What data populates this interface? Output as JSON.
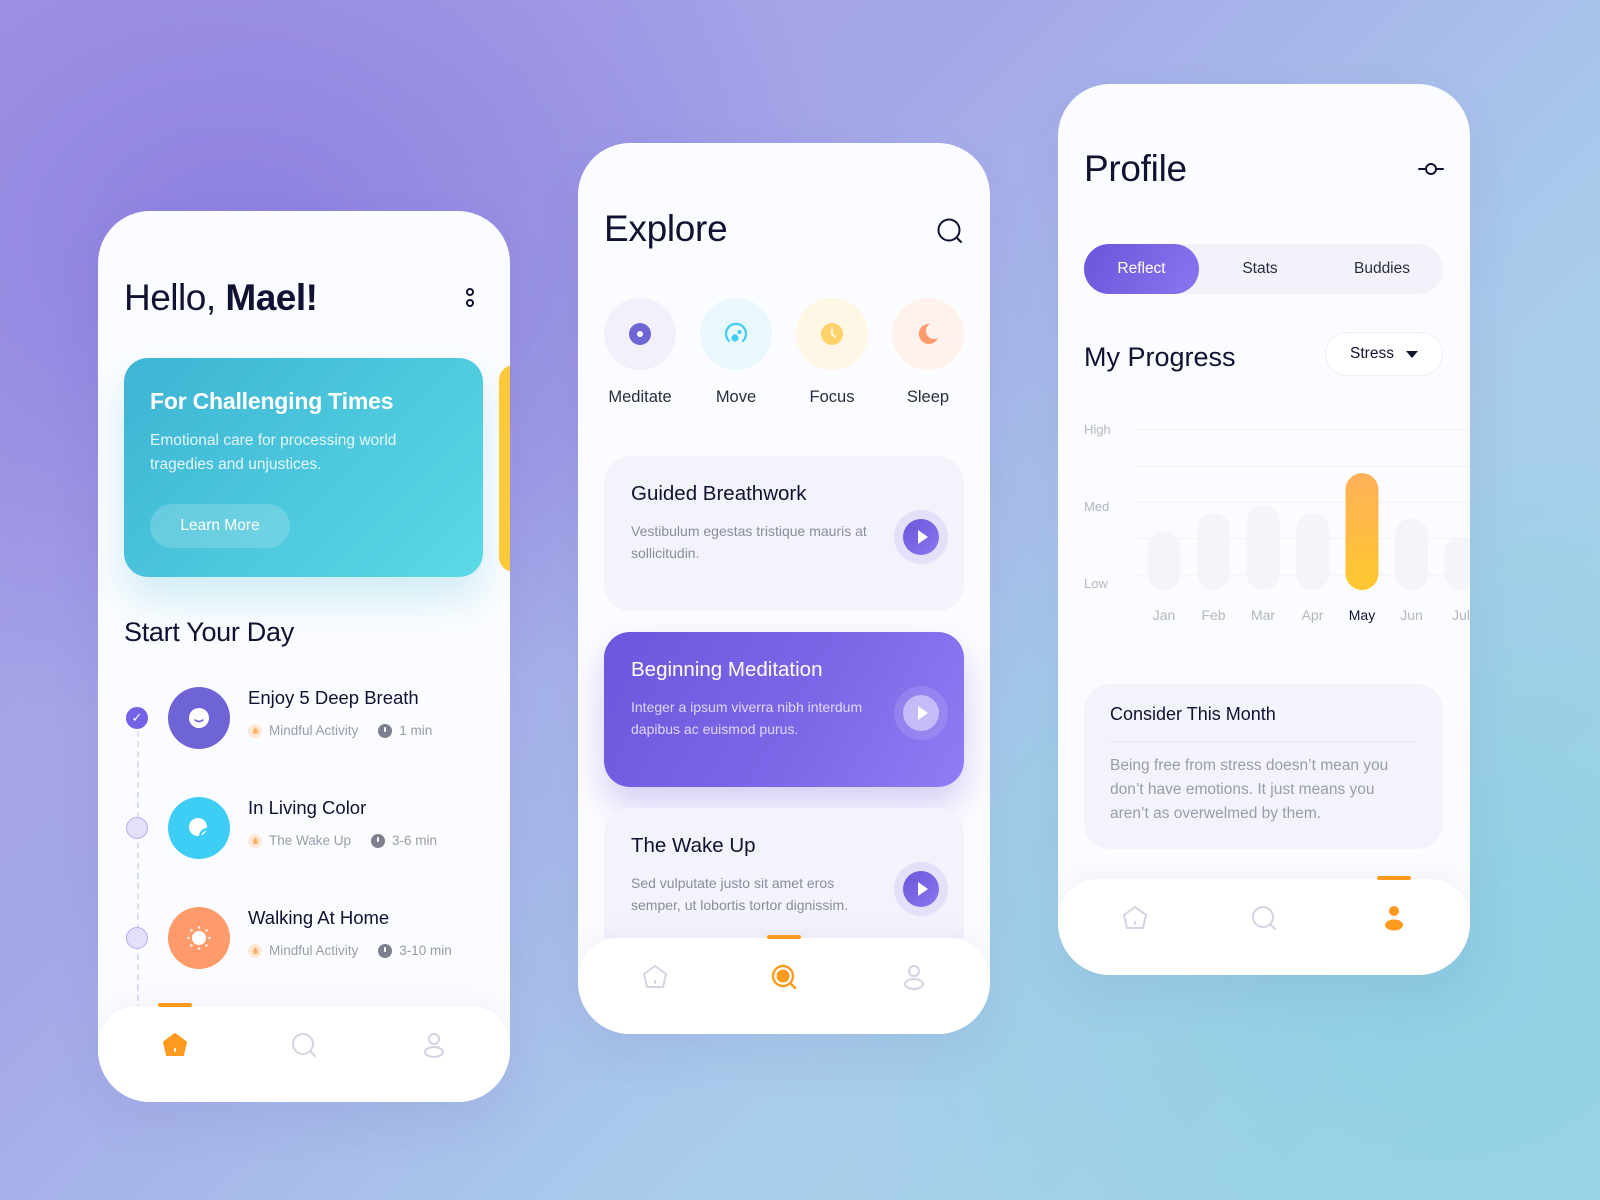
{
  "colors": {
    "accent_purple": "#6b57dc",
    "accent_orange": "#ff9a1f",
    "hero_teal": "#4fcade",
    "peek_yellow": "#ffc93c",
    "text_dark": "#0f1230",
    "text_muted": "#9a9cab"
  },
  "home": {
    "greeting_prefix": "Hello,",
    "greeting_name": "Mael!",
    "menu_icon": "more-vertical-icon",
    "hero": {
      "title": "For Challenging Times",
      "subtitle": "Emotional care for processing world tragedies and unjustices.",
      "button": "Learn More"
    },
    "section_title": "Start Your Day",
    "tasks": [
      {
        "title": "Enjoy 5 Deep Breath",
        "category": "Mindful Activity",
        "duration": "1 min",
        "done": true,
        "icon": "smile-icon",
        "color": "#6e64d6"
      },
      {
        "title": "In Living Color",
        "category": "The Wake Up",
        "duration": "3-6 min",
        "done": false,
        "icon": "color-icon",
        "color": "#3ecdf5"
      },
      {
        "title": "Walking At Home",
        "category": "Mindful Activity",
        "duration": "3-10 min",
        "done": false,
        "icon": "sun-icon",
        "color": "#ff9a6a"
      }
    ],
    "tabbar": {
      "active": "home",
      "tabs": [
        "home",
        "search",
        "profile"
      ]
    }
  },
  "explore": {
    "title": "Explore",
    "categories": [
      {
        "label": "Meditate",
        "icon": "meditate-icon",
        "bg": "#f1f0fb",
        "fg": "#6e64d6"
      },
      {
        "label": "Move",
        "icon": "move-icon",
        "bg": "#eaf8fd",
        "fg": "#3ecdf5"
      },
      {
        "label": "Focus",
        "icon": "focus-icon",
        "bg": "#fff7e6",
        "fg": "#ffd36a"
      },
      {
        "label": "Sleep",
        "icon": "sleep-icon",
        "bg": "#fff1ec",
        "fg": "#ff9a6a"
      }
    ],
    "cards": [
      {
        "title": "Guided Breathwork",
        "desc": "Vestibulum egestas tristique mauris at sollicitudin.",
        "active": false
      },
      {
        "title": "Beginning Meditation",
        "desc": "Integer a ipsum viverra nibh interdum dapibus ac euismod purus.",
        "active": true
      },
      {
        "title": "The Wake Up",
        "desc": "Sed vulputate justo sit amet eros semper, ut lobortis tortor dignissim.",
        "active": false
      }
    ],
    "tabbar": {
      "active": "search",
      "tabs": [
        "home",
        "search",
        "profile"
      ]
    }
  },
  "profile": {
    "title": "Profile",
    "segments": [
      {
        "label": "Reflect",
        "active": true
      },
      {
        "label": "Stats",
        "active": false
      },
      {
        "label": "Buddies",
        "active": false
      }
    ],
    "progress_title": "My Progress",
    "filter_selected": "Stress",
    "consider": {
      "title": "Consider This Month",
      "body": "Being free from stress doesn’t mean you don’t have emotions. It just means you aren’t as overwelmed by them."
    },
    "tabbar": {
      "active": "profile",
      "tabs": [
        "home",
        "search",
        "profile"
      ]
    }
  },
  "chart_data": {
    "type": "bar",
    "title": "My Progress",
    "ylabel": "Stress",
    "xlabel": "",
    "y_tick_labels": [
      "Low",
      "Med",
      "High"
    ],
    "ylim": [
      0,
      3
    ],
    "grid": true,
    "categories": [
      "Jan",
      "Feb",
      "Mar",
      "Apr",
      "May",
      "Jun",
      "Jul"
    ],
    "values": [
      1.1,
      1.45,
      1.6,
      1.45,
      2.2,
      1.35,
      1.0
    ],
    "highlight": "May",
    "highlight_color": "#ffc12f",
    "bar_color": "#f4f4fb"
  }
}
